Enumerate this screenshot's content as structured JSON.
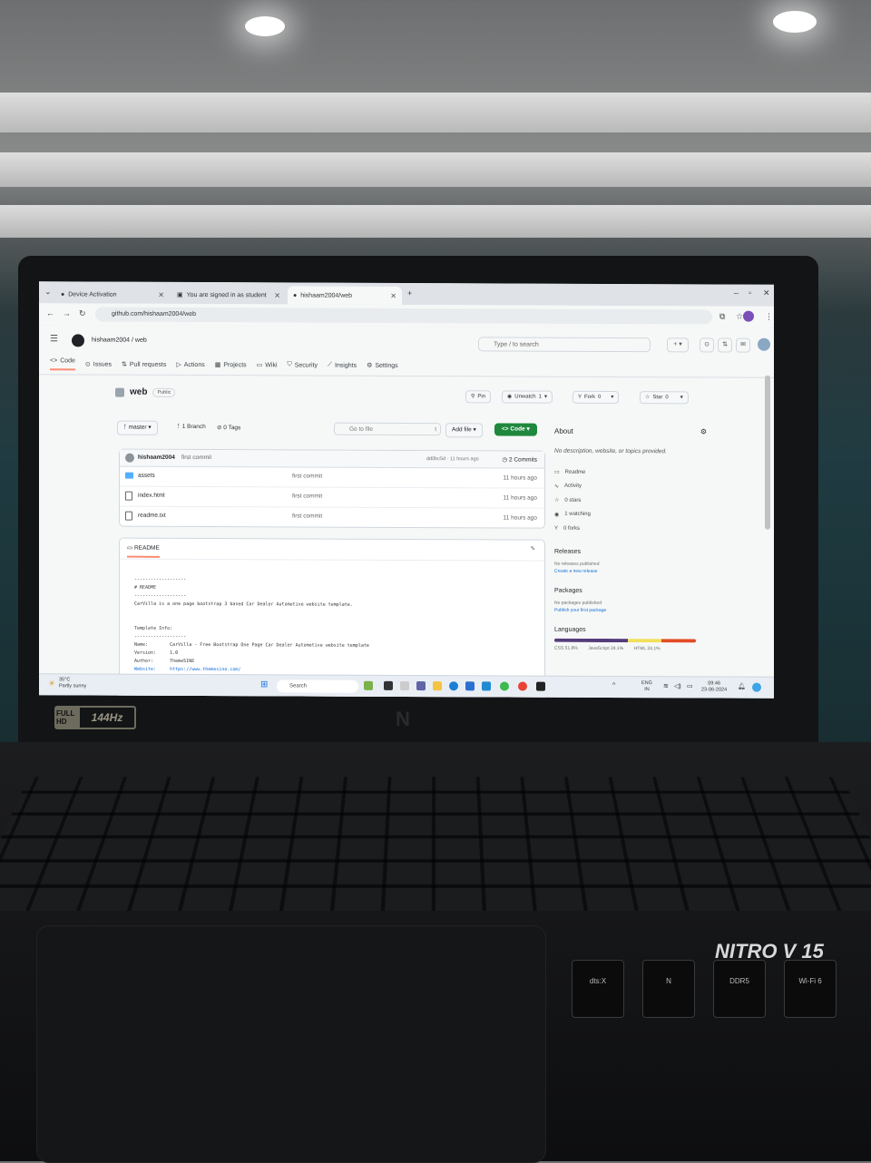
{
  "browser": {
    "tabs": [
      {
        "title": "Device Activation"
      },
      {
        "title": "You are signed in as student"
      },
      {
        "title": "hishaam2004/web"
      }
    ],
    "url": "github.com/hishaam2004/web"
  },
  "header": {
    "owner": "hishaam2004",
    "separator": "/",
    "repo": "web",
    "search_placeholder": "Type / to search"
  },
  "repo_nav": {
    "items": [
      "Code",
      "Issues",
      "Pull requests",
      "Actions",
      "Projects",
      "Wiki",
      "Security",
      "Insights",
      "Settings"
    ]
  },
  "repo": {
    "name": "web",
    "visibility": "Public",
    "pin": "Pin",
    "unwatch": "Unwatch",
    "watch_count": "1",
    "fork": "Fork",
    "fork_count": "0",
    "star": "Star",
    "star_count": "0"
  },
  "toolbar": {
    "branch": "master",
    "branches": "1 Branch",
    "tags": "0 Tags",
    "goto_placeholder": "Go to file",
    "goto_shortcut": "t",
    "add_file": "Add file",
    "code": "Code"
  },
  "commit": {
    "author": "hishaam2004",
    "message": "first commit",
    "hash_time": "dd0bc5d · 11 hours ago",
    "commits": "2 Commits"
  },
  "files": [
    {
      "name": "assets",
      "type": "folder",
      "message": "first commit",
      "date": "11 hours ago"
    },
    {
      "name": "index.html",
      "type": "file",
      "message": "first commit",
      "date": "11 hours ago"
    },
    {
      "name": "readme.txt",
      "type": "file",
      "message": "first commit",
      "date": "11 hours ago"
    }
  ],
  "readme": {
    "tab": "README",
    "lines": [
      {
        "t": "-------------------"
      },
      {
        "t": "# README"
      },
      {
        "t": "-------------------"
      },
      {
        "t": "CarVilla is a one page bootstrap 3 based Car Dealer Automotive website template."
      },
      {
        "t": ""
      },
      {
        "t": ""
      },
      {
        "t": "Template Info:"
      },
      {
        "t": "-------------------"
      },
      {
        "t": "Name:        CarVilla - Free Bootstrap One Page Car Dealer Automotive website template"
      },
      {
        "t": "Version:     1.0"
      },
      {
        "t": "Author:      ThemeSINE"
      },
      {
        "t": "Website:     https://www.themesine.com/"
      }
    ]
  },
  "about": {
    "title": "About",
    "description": "No description, website, or topics provided.",
    "items": [
      "Readme",
      "Activity",
      "0 stars",
      "1 watching",
      "0 forks"
    ],
    "releases_title": "Releases",
    "releases_text": "No releases published",
    "releases_link": "Create a new release",
    "packages_title": "Packages",
    "packages_text": "No packages published",
    "packages_link": "Publish your first package",
    "languages_title": "Languages",
    "languages": [
      {
        "name": "CSS",
        "percent": "51.8%",
        "color": "#563d7c"
      },
      {
        "name": "JavaScript",
        "percent": "24.1%",
        "color": "#f1e05a"
      },
      {
        "name": "HTML",
        "percent": "24.1%",
        "color": "#e34c26"
      }
    ]
  },
  "taskbar": {
    "temp": "35°C",
    "weather": "Partly sunny",
    "search": "Search",
    "lang": "ENG",
    "region": "IN",
    "time": "09:46",
    "date": "23-06-2024"
  },
  "device": {
    "badge_left": "FULL HD",
    "badge_right": "144Hz",
    "brand": "NITRO V 15",
    "stickers": [
      "dts:X",
      "N",
      "DDR5",
      "Wi-Fi 6"
    ]
  }
}
